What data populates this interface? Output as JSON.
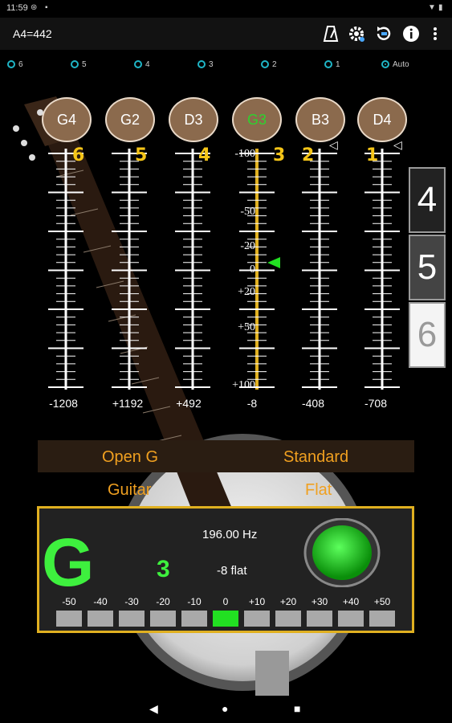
{
  "status_bar": {
    "time": "11:59"
  },
  "app_bar": {
    "title": "A4=442",
    "icons": [
      "metronome-icon",
      "settings-icon",
      "reset-icon",
      "info-icon",
      "more-icon"
    ]
  },
  "string_selector": {
    "options": [
      "6",
      "5",
      "4",
      "3",
      "2",
      "1",
      "Auto"
    ],
    "selected": "Auto"
  },
  "strings": [
    {
      "note": "G4",
      "number": "6",
      "cents": "-1208"
    },
    {
      "note": "G2",
      "number": "5",
      "cents": "+1192"
    },
    {
      "note": "D3",
      "number": "4",
      "cents": "+492"
    },
    {
      "note": "G3",
      "number": "3",
      "cents": "-8",
      "active": true
    },
    {
      "note": "B3",
      "number": "2",
      "cents": "-408"
    },
    {
      "note": "D4",
      "number": "1",
      "cents": "-708"
    }
  ],
  "scale_labels": [
    "-100",
    "-50",
    "-20",
    "0",
    "+20",
    "+50",
    "+100"
  ],
  "instrument_panel": [
    "4",
    "5",
    "6"
  ],
  "tuning": {
    "name_left": "Open G",
    "name_right": "Standard",
    "instrument": "Guitar",
    "mode": "Flat"
  },
  "display": {
    "note": "G",
    "octave": "3",
    "frequency": "196.00 Hz",
    "offset": "-8 flat",
    "meter_labels": [
      "-50",
      "-40",
      "-30",
      "-20",
      "-10",
      "0",
      "+10",
      "+20",
      "+30",
      "+40",
      "+50"
    ],
    "meter_active_index": 5
  },
  "colors": {
    "accent": "#f5c518",
    "in_tune": "#22e022",
    "radio": "#1fb6c7",
    "note_bg": "#8b6a4d"
  }
}
